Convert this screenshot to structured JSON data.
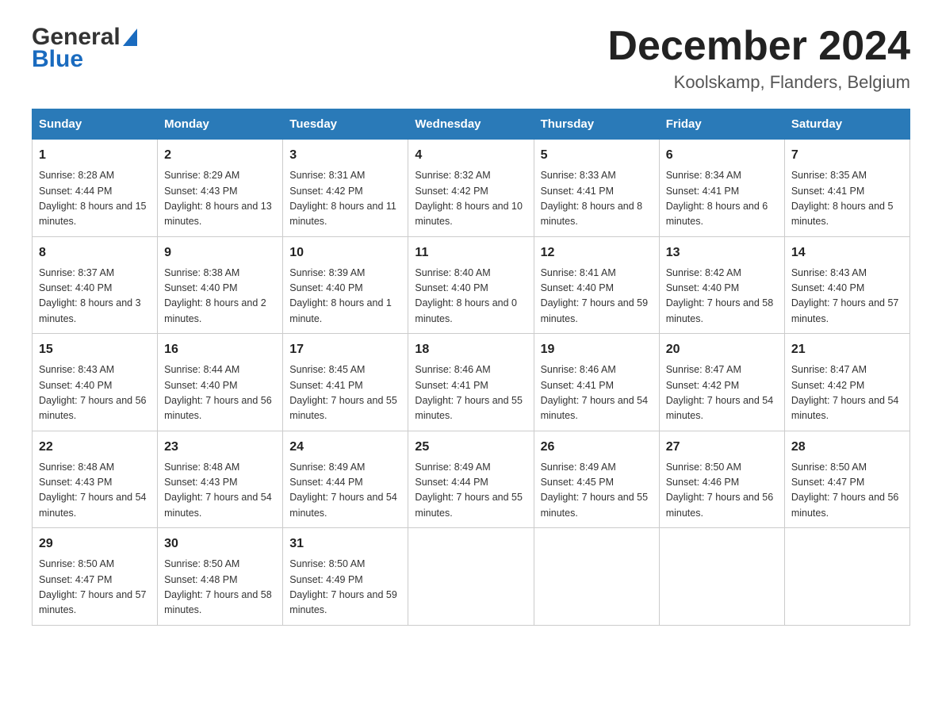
{
  "header": {
    "logo_general": "General",
    "logo_blue": "Blue",
    "title": "December 2024",
    "subtitle": "Koolskamp, Flanders, Belgium"
  },
  "columns": [
    "Sunday",
    "Monday",
    "Tuesday",
    "Wednesday",
    "Thursday",
    "Friday",
    "Saturday"
  ],
  "weeks": [
    [
      {
        "num": "1",
        "sunrise": "8:28 AM",
        "sunset": "4:44 PM",
        "daylight": "8 hours and 15 minutes."
      },
      {
        "num": "2",
        "sunrise": "8:29 AM",
        "sunset": "4:43 PM",
        "daylight": "8 hours and 13 minutes."
      },
      {
        "num": "3",
        "sunrise": "8:31 AM",
        "sunset": "4:42 PM",
        "daylight": "8 hours and 11 minutes."
      },
      {
        "num": "4",
        "sunrise": "8:32 AM",
        "sunset": "4:42 PM",
        "daylight": "8 hours and 10 minutes."
      },
      {
        "num": "5",
        "sunrise": "8:33 AM",
        "sunset": "4:41 PM",
        "daylight": "8 hours and 8 minutes."
      },
      {
        "num": "6",
        "sunrise": "8:34 AM",
        "sunset": "4:41 PM",
        "daylight": "8 hours and 6 minutes."
      },
      {
        "num": "7",
        "sunrise": "8:35 AM",
        "sunset": "4:41 PM",
        "daylight": "8 hours and 5 minutes."
      }
    ],
    [
      {
        "num": "8",
        "sunrise": "8:37 AM",
        "sunset": "4:40 PM",
        "daylight": "8 hours and 3 minutes."
      },
      {
        "num": "9",
        "sunrise": "8:38 AM",
        "sunset": "4:40 PM",
        "daylight": "8 hours and 2 minutes."
      },
      {
        "num": "10",
        "sunrise": "8:39 AM",
        "sunset": "4:40 PM",
        "daylight": "8 hours and 1 minute."
      },
      {
        "num": "11",
        "sunrise": "8:40 AM",
        "sunset": "4:40 PM",
        "daylight": "8 hours and 0 minutes."
      },
      {
        "num": "12",
        "sunrise": "8:41 AM",
        "sunset": "4:40 PM",
        "daylight": "7 hours and 59 minutes."
      },
      {
        "num": "13",
        "sunrise": "8:42 AM",
        "sunset": "4:40 PM",
        "daylight": "7 hours and 58 minutes."
      },
      {
        "num": "14",
        "sunrise": "8:43 AM",
        "sunset": "4:40 PM",
        "daylight": "7 hours and 57 minutes."
      }
    ],
    [
      {
        "num": "15",
        "sunrise": "8:43 AM",
        "sunset": "4:40 PM",
        "daylight": "7 hours and 56 minutes."
      },
      {
        "num": "16",
        "sunrise": "8:44 AM",
        "sunset": "4:40 PM",
        "daylight": "7 hours and 56 minutes."
      },
      {
        "num": "17",
        "sunrise": "8:45 AM",
        "sunset": "4:41 PM",
        "daylight": "7 hours and 55 minutes."
      },
      {
        "num": "18",
        "sunrise": "8:46 AM",
        "sunset": "4:41 PM",
        "daylight": "7 hours and 55 minutes."
      },
      {
        "num": "19",
        "sunrise": "8:46 AM",
        "sunset": "4:41 PM",
        "daylight": "7 hours and 54 minutes."
      },
      {
        "num": "20",
        "sunrise": "8:47 AM",
        "sunset": "4:42 PM",
        "daylight": "7 hours and 54 minutes."
      },
      {
        "num": "21",
        "sunrise": "8:47 AM",
        "sunset": "4:42 PM",
        "daylight": "7 hours and 54 minutes."
      }
    ],
    [
      {
        "num": "22",
        "sunrise": "8:48 AM",
        "sunset": "4:43 PM",
        "daylight": "7 hours and 54 minutes."
      },
      {
        "num": "23",
        "sunrise": "8:48 AM",
        "sunset": "4:43 PM",
        "daylight": "7 hours and 54 minutes."
      },
      {
        "num": "24",
        "sunrise": "8:49 AM",
        "sunset": "4:44 PM",
        "daylight": "7 hours and 54 minutes."
      },
      {
        "num": "25",
        "sunrise": "8:49 AM",
        "sunset": "4:44 PM",
        "daylight": "7 hours and 55 minutes."
      },
      {
        "num": "26",
        "sunrise": "8:49 AM",
        "sunset": "4:45 PM",
        "daylight": "7 hours and 55 minutes."
      },
      {
        "num": "27",
        "sunrise": "8:50 AM",
        "sunset": "4:46 PM",
        "daylight": "7 hours and 56 minutes."
      },
      {
        "num": "28",
        "sunrise": "8:50 AM",
        "sunset": "4:47 PM",
        "daylight": "7 hours and 56 minutes."
      }
    ],
    [
      {
        "num": "29",
        "sunrise": "8:50 AM",
        "sunset": "4:47 PM",
        "daylight": "7 hours and 57 minutes."
      },
      {
        "num": "30",
        "sunrise": "8:50 AM",
        "sunset": "4:48 PM",
        "daylight": "7 hours and 58 minutes."
      },
      {
        "num": "31",
        "sunrise": "8:50 AM",
        "sunset": "4:49 PM",
        "daylight": "7 hours and 59 minutes."
      },
      null,
      null,
      null,
      null
    ]
  ],
  "labels": {
    "sunrise": "Sunrise:",
    "sunset": "Sunset:",
    "daylight": "Daylight:"
  }
}
